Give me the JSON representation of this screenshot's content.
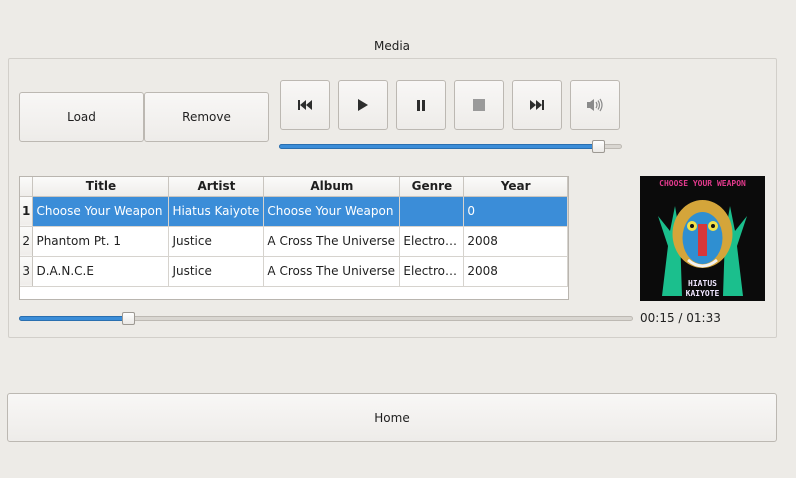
{
  "media": {
    "title": "Media",
    "load_label": "Load",
    "remove_label": "Remove",
    "volume_level": 0.95,
    "position_fraction": 0.17,
    "time_text": "00:15 / 01:33",
    "table": {
      "headers": [
        "Title",
        "Artist",
        "Album",
        "Genre",
        "Year"
      ],
      "rows": [
        {
          "num": "1",
          "title": "Choose Your Weapon",
          "artist": "Hiatus Kaiyote",
          "album": "Choose Your Weapon",
          "genre": "",
          "year": "0"
        },
        {
          "num": "2",
          "title": "Phantom Pt. 1",
          "artist": "Justice",
          "album": "A Cross The Universe",
          "genre": "Electro…",
          "year": "2008"
        },
        {
          "num": "3",
          "title": "D.A.N.C.E",
          "artist": "Justice",
          "album": "A Cross The Universe",
          "genre": "Electro…",
          "year": "2008"
        }
      ]
    },
    "album_art": {
      "top_text": "CHOOSE YOUR WEAPON",
      "bottom_text_1": "HIATUS",
      "bottom_text_2": "KAIYOTE"
    }
  },
  "home_label": "Home",
  "colors": {
    "accent": "#3b8dd8",
    "background": "#edebe7"
  }
}
